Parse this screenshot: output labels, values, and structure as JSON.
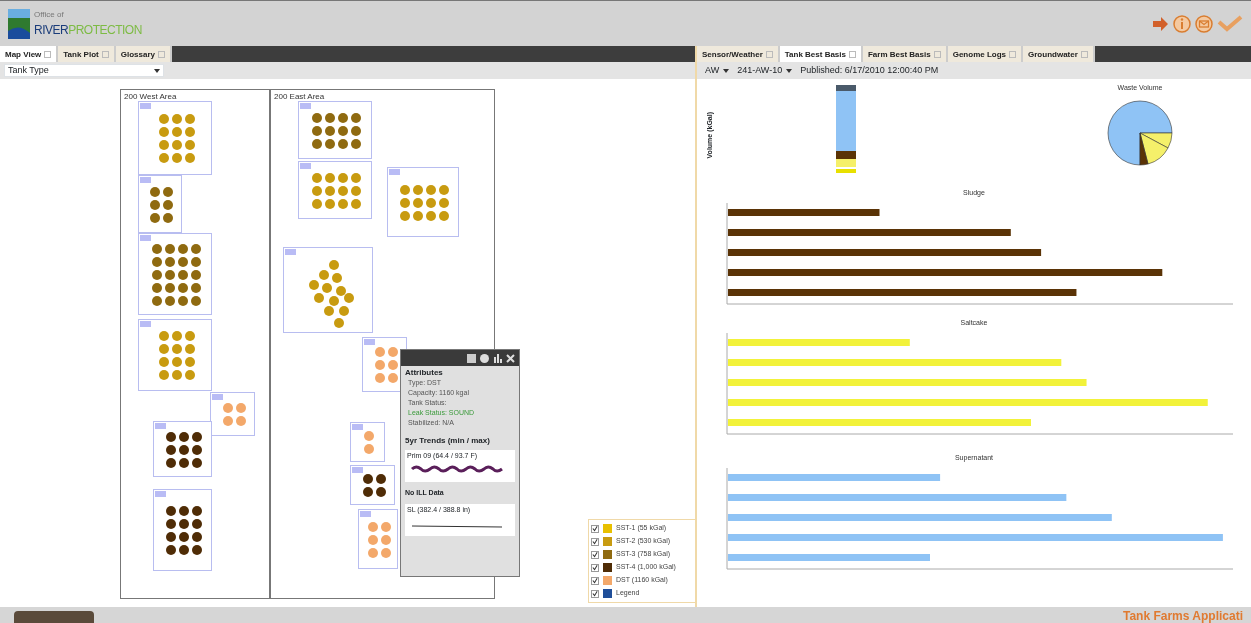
{
  "header": {
    "logo_small": "Office of",
    "logo_main": "RIVER",
    "logo_accent": "PROTECTION"
  },
  "left_tabs": [
    {
      "label": "Map View",
      "selected": true
    },
    {
      "label": "Tank Plot",
      "selected": false
    },
    {
      "label": "Glossary",
      "selected": false
    }
  ],
  "right_tabs": [
    {
      "label": "Sensor/Weather",
      "selected": false
    },
    {
      "label": "Tank Best Basis",
      "selected": true
    },
    {
      "label": "Farm Best Basis",
      "selected": false
    },
    {
      "label": "Genome Logs",
      "selected": false
    },
    {
      "label": "Groundwater",
      "selected": false
    }
  ],
  "map_filter": {
    "value": "Tank Type"
  },
  "map": {
    "areas": [
      "200 West Area",
      "200 East Area"
    ]
  },
  "popup": {
    "section": "Attributes",
    "attributes": [
      {
        "text": "Type: DST",
        "kind": "plain"
      },
      {
        "text": "Capacity: 1160 kgal",
        "kind": "plain"
      },
      {
        "text": "Tank Status:",
        "kind": "plain"
      },
      {
        "text": "Leak Status: SOUND",
        "kind": "good"
      },
      {
        "text": "Stabilized: N/A",
        "kind": "plain"
      }
    ],
    "trends_title": "5yr Trends (min / max)",
    "trends": [
      {
        "label": "Prim 09 (64.4 / 93.7 F)",
        "kind": "wave"
      },
      {
        "label": "No ILL Data",
        "kind": "none"
      },
      {
        "label": "SL (382.4 / 388.8 in)",
        "kind": "flat"
      }
    ]
  },
  "legend": [
    {
      "label": "SST-1 (55 kGal)",
      "checked": true,
      "color": "#e8c000"
    },
    {
      "label": "SST-2 (530 kGal)",
      "checked": true,
      "color": "#c89b10"
    },
    {
      "label": "SST-3 (758 kGal)",
      "checked": true,
      "color": "#8f6a10"
    },
    {
      "label": "SST-4 (1,000 kGal)",
      "checked": true,
      "color": "#4f2c06"
    },
    {
      "label": "DST (1160 kGal)",
      "checked": true,
      "color": "#f3a86a"
    },
    {
      "label": "Legend",
      "checked": true,
      "color": "#1f4e99"
    }
  ],
  "toolbar": {
    "farm": "AW",
    "tank": "241-AW-10",
    "published": "Published: 6/17/2010 12:00:40 PM"
  },
  "charts": {
    "ylabel": "Volume (kGal)",
    "titles": [
      "Waste Volume",
      "Sludge",
      "Saltcake",
      "Supernatant"
    ]
  },
  "status_bar": {
    "app_title": "Tank Farms Applicati"
  }
}
